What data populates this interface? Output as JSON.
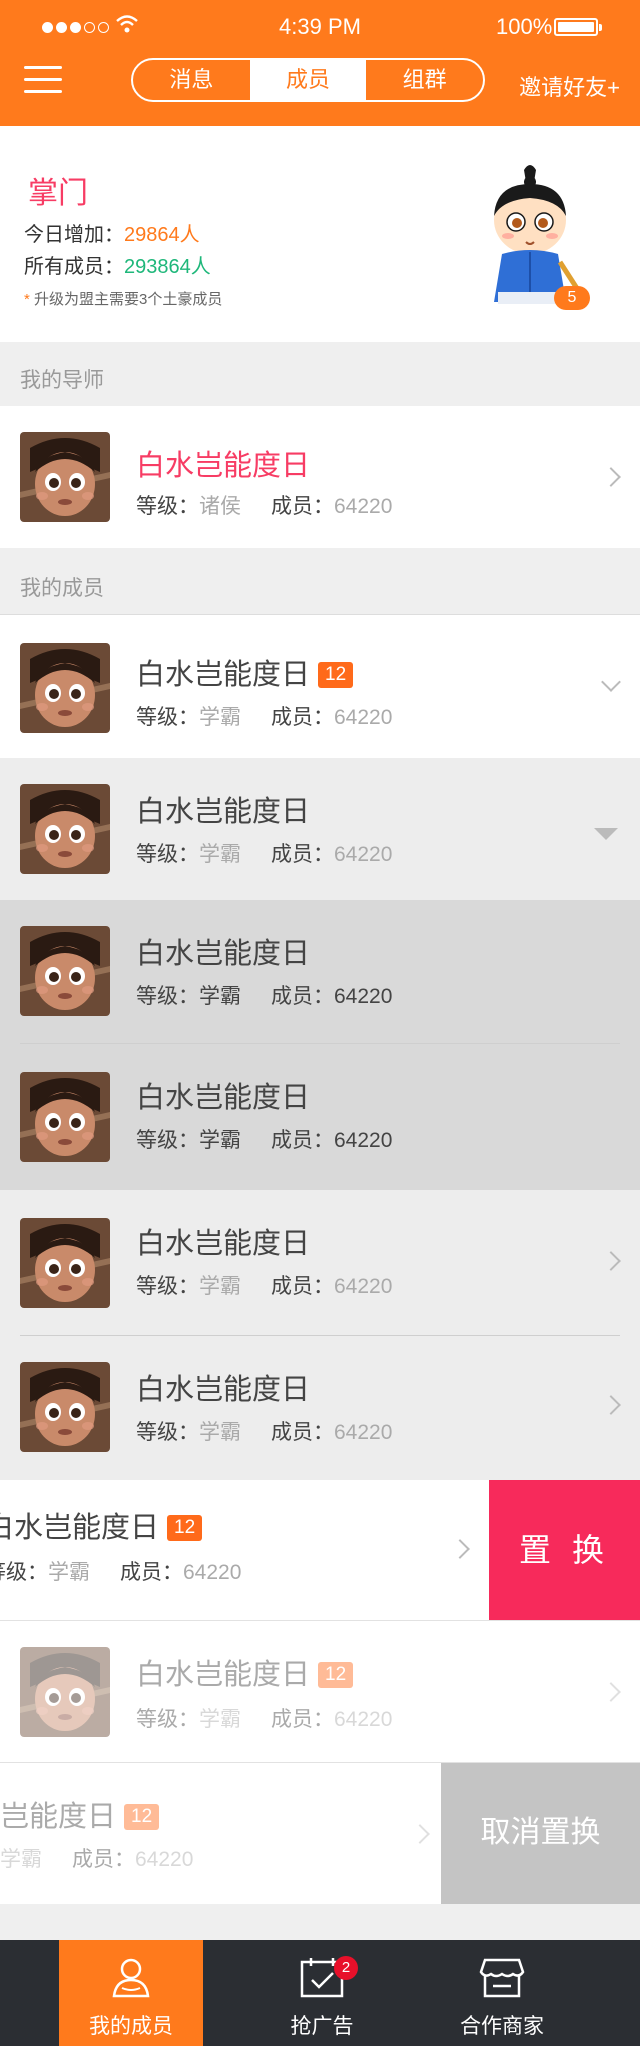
{
  "status_bar": {
    "time": "4:39 PM",
    "battery": "100%"
  },
  "header": {
    "tabs": [
      {
        "label": "消息",
        "active": false
      },
      {
        "label": "成员",
        "active": true
      },
      {
        "label": "组群",
        "active": false
      }
    ],
    "invite_label": "邀请好友+"
  },
  "profile": {
    "title": "掌门",
    "today_label": "今日增加：",
    "today_value": "29864人",
    "total_label": "所有成员：",
    "total_value": "293864人",
    "note_star": "*",
    "note": "升级为盟主需要3个土豪成员",
    "level": "5"
  },
  "mentor_section": {
    "label": "我的导师"
  },
  "mentor": {
    "name": "白水岂能度日",
    "level_label": "等级：",
    "level_value": "诸侯",
    "members_label": "成员：",
    "members_value": "64220"
  },
  "members_section": {
    "label": "我的成员"
  },
  "members": [
    {
      "name": "白水岂能度日",
      "badge": "12",
      "level_label": "等级：",
      "level_value": "学霸",
      "members_label": "成员：",
      "members_value": "64220"
    },
    {
      "name": "白水岂能度日",
      "level_label": "等级：",
      "level_value": "学霸",
      "members_label": "成员：",
      "members_value": "64220"
    },
    {
      "name": "白水岂能度日",
      "level_label": "等级：",
      "level_value": "学霸",
      "members_label": "成员：",
      "members_value": "64220"
    },
    {
      "name": "白水岂能度日",
      "level_label": "等级：",
      "level_value": "学霸",
      "members_label": "成员：",
      "members_value": "64220"
    },
    {
      "name": "白水岂能度日",
      "level_label": "等级：",
      "level_value": "学霸",
      "members_label": "成员：",
      "members_value": "64220"
    },
    {
      "name": "白水岂能度日",
      "level_label": "等级：",
      "level_value": "学霸",
      "members_label": "成员：",
      "members_value": "64220"
    },
    {
      "name": "白水岂能度日",
      "badge": "12",
      "level_label": "等级：",
      "level_value": "学霸",
      "members_label": "成员：",
      "members_value": "64220",
      "action": "置 换"
    },
    {
      "name": "白水岂能度日",
      "badge": "12",
      "level_label": "等级：",
      "level_value": "学霸",
      "members_label": "成员：",
      "members_value": "64220"
    },
    {
      "name": "岂能度日",
      "badge": "12",
      "level_label": "",
      "level_value": "学霸",
      "members_label": "成员：",
      "members_value": "64220",
      "action": "取消置换"
    }
  ],
  "tabbar": {
    "items": [
      {
        "label": "我的成员",
        "icon": "members-icon",
        "active": true
      },
      {
        "label": "抢广告",
        "icon": "calendar-check-icon",
        "badge": "2"
      },
      {
        "label": "合作商家",
        "icon": "store-icon"
      }
    ]
  },
  "colors": {
    "primary": "#ff7a1c",
    "pink": "#f73c64",
    "green": "#1eb77a",
    "tabbar": "#2b2e33",
    "swap": "#f72a5b",
    "cancel": "#c4c4c4"
  }
}
